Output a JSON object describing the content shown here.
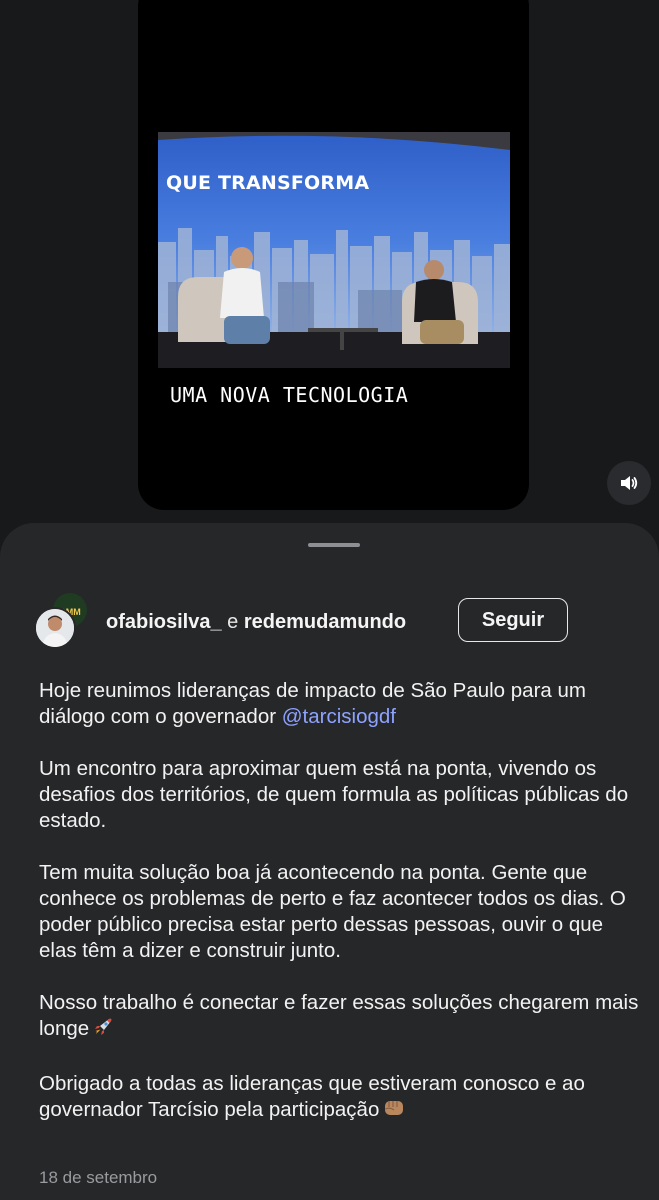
{
  "video": {
    "headline": "QUE TRANSFORMA",
    "caption": "UMA NOVA TECNOLOGIA"
  },
  "controls": {
    "mute_icon": "speaker-volume-icon"
  },
  "post": {
    "author_primary": "ofabiosilva_",
    "conjunction": "e",
    "author_secondary": "redemudamundo",
    "collab_avatar_text": "DMM",
    "follow_label": "Seguir",
    "p1_text": "Hoje reunimos lideranças de impacto de São Paulo para um diálogo com o governador ",
    "p1_mention": "@tarcisiogdf",
    "p2": "Um encontro para aproximar quem está na ponta, vivendo os desafios dos territórios, de quem formula as políticas públicas do estado.",
    "p3": "Tem muita solução boa já acontecendo na ponta. Gente que conhece os problemas de perto e faz acontecer todos os dias. O poder público precisa estar perto dessas pessoas, ouvir o que elas têm a dizer e construir junto.",
    "p4": "Nosso trabalho é conectar e fazer essas soluções chegarem mais longe",
    "p4_emoji": "rocket-icon",
    "p5": "Obrigado a todas as lideranças que estiveram conosco e ao governador Tarcísio pela participação",
    "p5_emoji": "fist-icon",
    "date": "18 de setembro"
  },
  "colors": {
    "background": "#18191b",
    "sheet": "#262729",
    "mention": "#8ea2ff",
    "muted_text": "#9a9b9e"
  }
}
